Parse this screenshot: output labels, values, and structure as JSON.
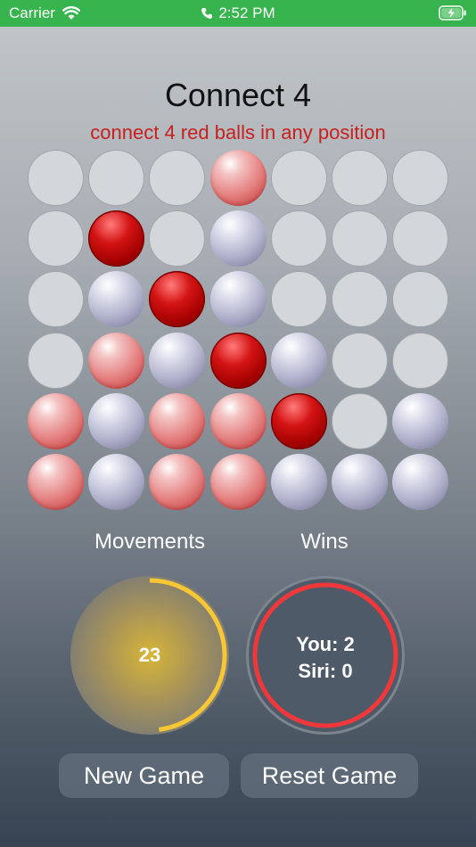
{
  "status_bar": {
    "carrier": "Carrier",
    "time": "2:52 PM"
  },
  "game": {
    "title": "Connect 4",
    "subtitle": "connect 4 red balls in any position",
    "board": [
      [
        "empty",
        "empty",
        "empty",
        "red",
        "empty",
        "empty",
        "empty"
      ],
      [
        "empty",
        "dark",
        "empty",
        "blue",
        "empty",
        "empty",
        "empty"
      ],
      [
        "empty",
        "blue",
        "dark",
        "blue",
        "empty",
        "empty",
        "empty"
      ],
      [
        "empty",
        "red",
        "blue",
        "dark",
        "blue",
        "empty",
        "empty"
      ],
      [
        "red",
        "blue",
        "red",
        "red",
        "dark",
        "empty",
        "blue"
      ],
      [
        "red",
        "blue",
        "red",
        "red",
        "blue",
        "blue",
        "blue"
      ]
    ]
  },
  "stats": {
    "movements_label": "Movements",
    "wins_label": "Wins",
    "movements_value": "23",
    "movements_progress": 0.48,
    "wins_you": "You: 2",
    "wins_siri": "Siri:  0"
  },
  "buttons": {
    "new_game": "New Game",
    "reset_game": "Reset Game"
  },
  "colors": {
    "status_bar": "#37b44d",
    "subtitle": "#c8201f",
    "moves_ring": "#f8c735",
    "wins_ring": "#f0383a"
  }
}
